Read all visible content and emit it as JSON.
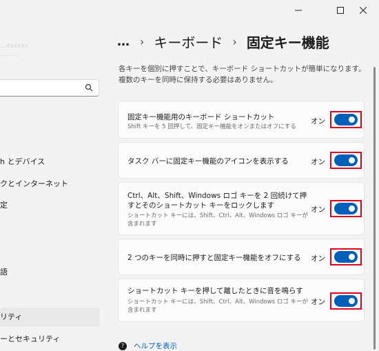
{
  "window": {
    "minimize_icon": "minimize-icon",
    "maximize_icon": "maximize-icon",
    "close_icon": "close-icon"
  },
  "sidebar": {
    "user_name": "...4xxxxx",
    "user_email": "...., ...",
    "search_placeholder": "",
    "items": [
      {
        "label": "h とデバイス"
      },
      {
        "label": "クとインターネット"
      },
      {
        "label": "定"
      },
      {
        "label": "語"
      },
      {
        "label": "リティ",
        "selected": true
      },
      {
        "label": "ーとセキュリティ"
      }
    ]
  },
  "breadcrumb": {
    "more": "…",
    "sep": "›",
    "parent": "キーボード",
    "current": "固定キー機能"
  },
  "description": "各キーを個別に押すことで、キーボード ショートカットが簡単になります。複数のキーを同時に保持する必要はありません。",
  "settings": [
    {
      "title": "固定キー機能用のキーボード ショートカット",
      "subtitle": "Shift キーを 5 回押して、固定キー機能をオンまたはオフにする",
      "state": "オン",
      "on": true
    },
    {
      "title": "タスク バーに固定キー機能のアイコンを表示する",
      "subtitle": "",
      "state": "オン",
      "on": true
    },
    {
      "title": "Ctrl、Alt、Shift、Windows ロゴ キーを 2 回続けて押すとそのショートカット キーをロックします",
      "subtitle": "ショートカット キーには、Shift、Ctrl、Alt、Windows ロゴ キーが含まれます",
      "state": "オン",
      "on": true
    },
    {
      "title": "2 つのキーを同時に押すと固定キー機能をオフにする",
      "subtitle": "",
      "state": "オン",
      "on": true
    },
    {
      "title": "ショートカット キーを押して離したときに音を鳴らす",
      "subtitle": "ショートカット キーには、Shift、Ctrl、Alt、Windows ロゴ キーが含まれます",
      "state": "オン",
      "on": true
    }
  ],
  "help": {
    "label": "ヘルプを表示"
  },
  "colors": {
    "accent": "#005fb8",
    "highlight": "#e0001b"
  }
}
